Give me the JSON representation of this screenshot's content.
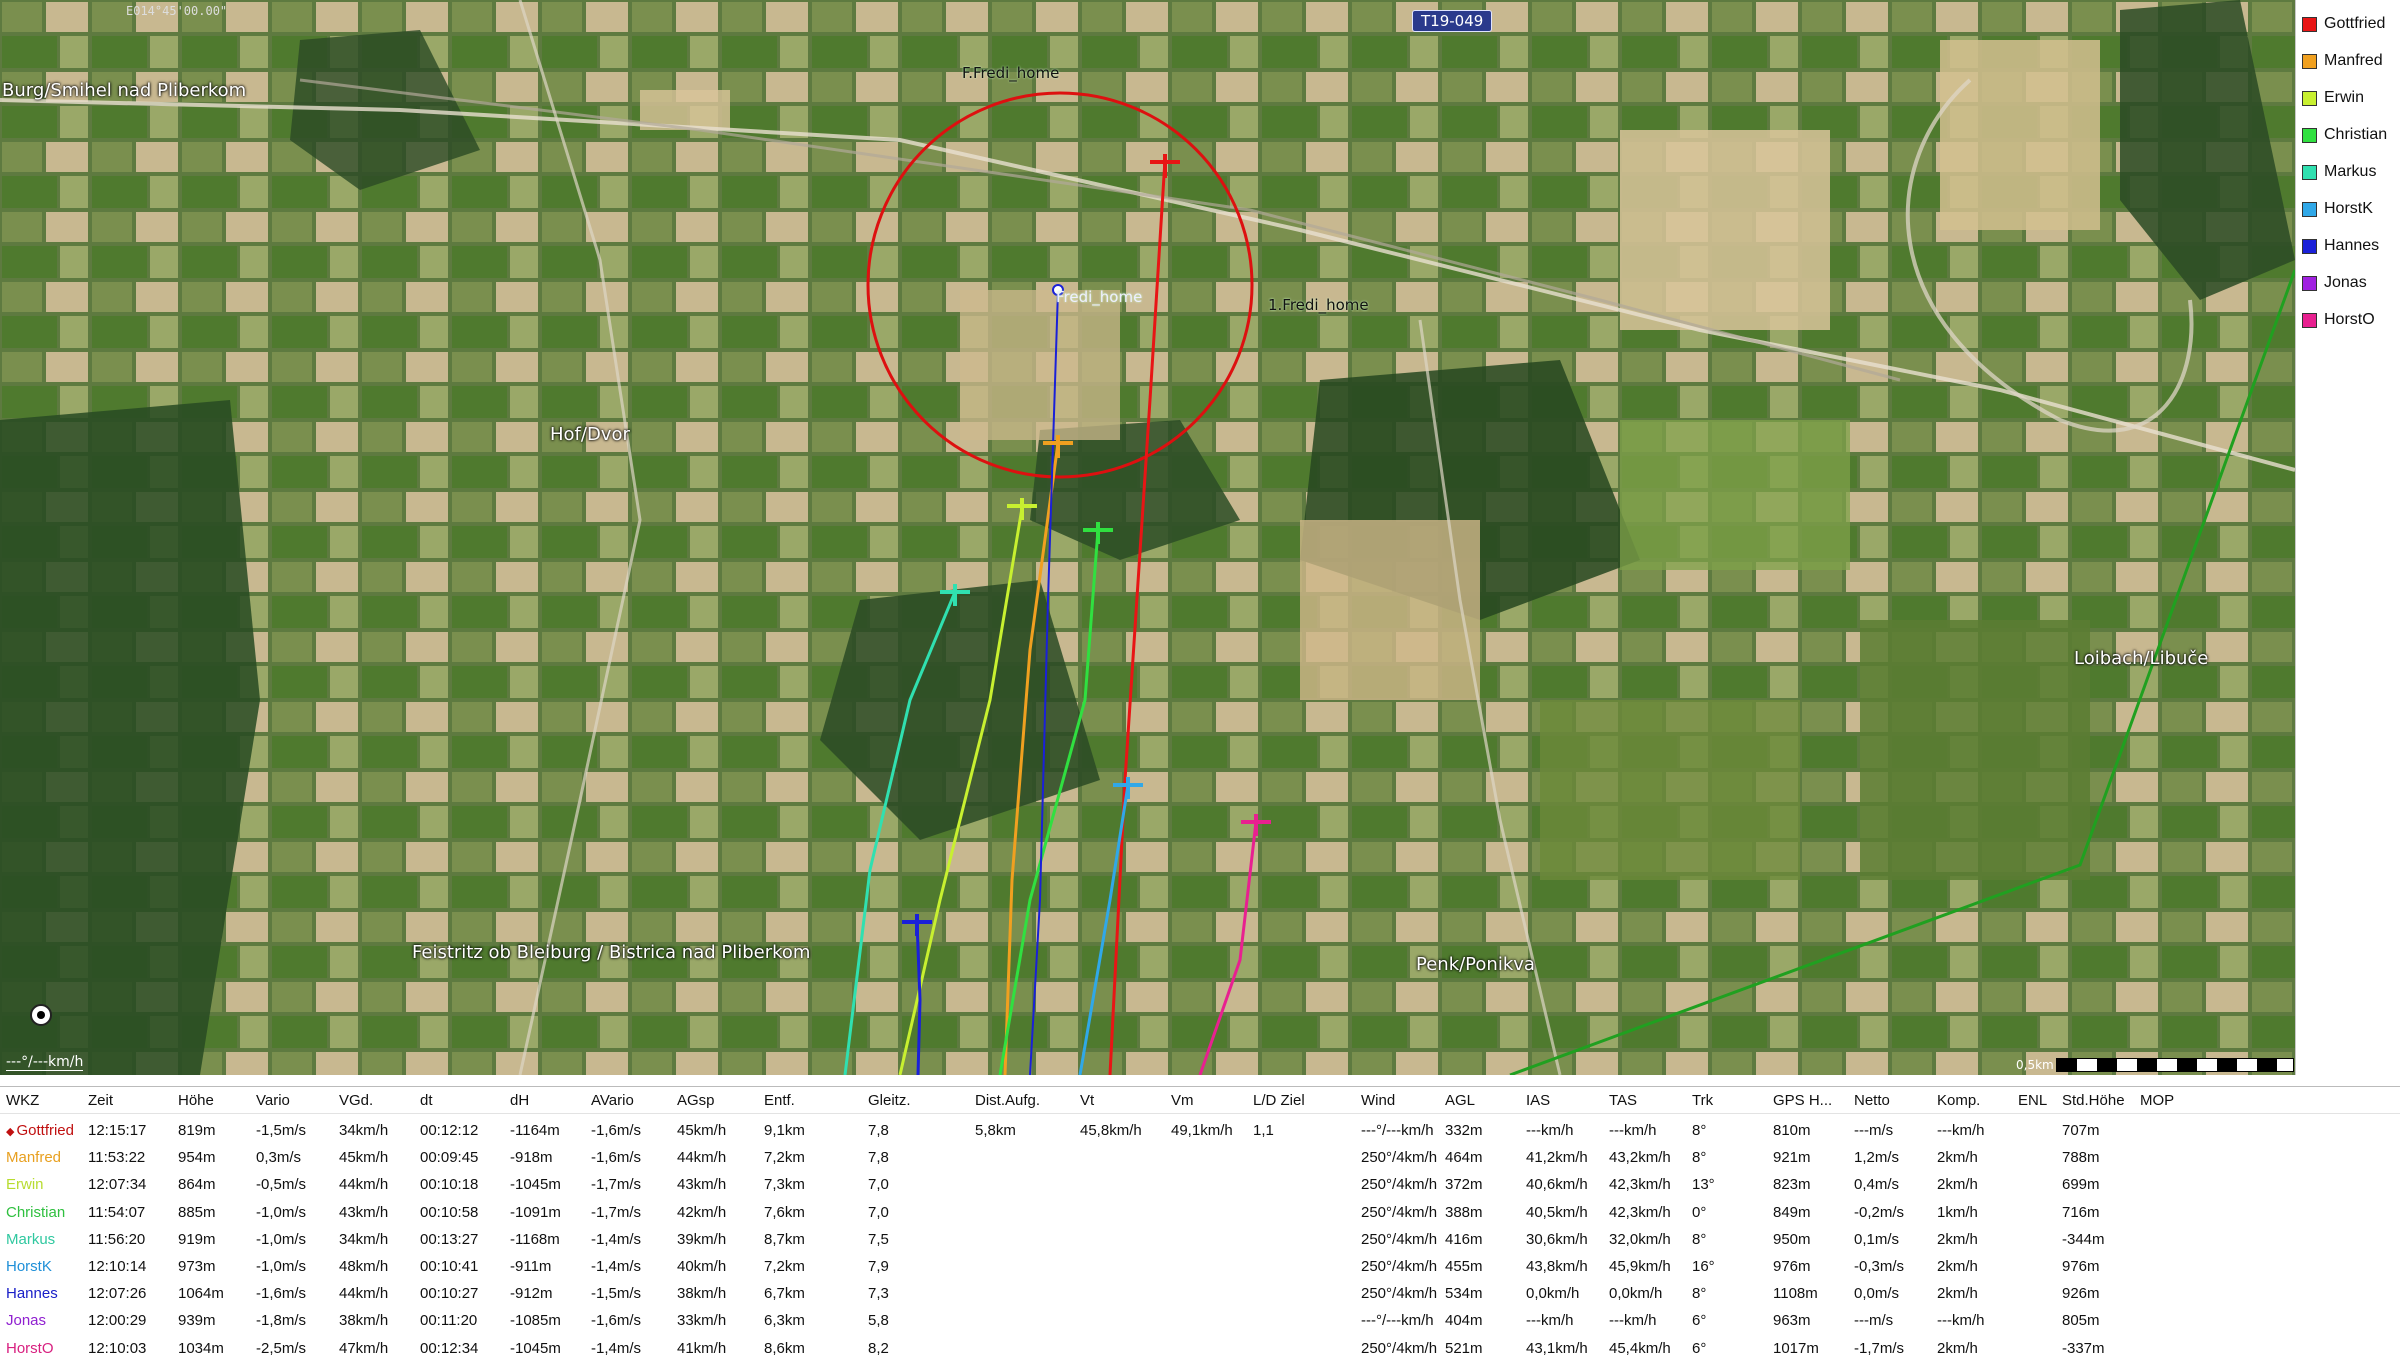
{
  "map": {
    "coord_label": "E014°45'00.00\"",
    "road_badge": "T19-049",
    "place_labels": [
      "Burg/Smihel nad Pliberkom",
      "Hof/Dvor",
      "Feistritz ob Bleiburg / Bistrica nad Pliberkom",
      "Penk/Ponikva",
      "Loibach/Libuče"
    ],
    "waypoints": [
      "F.Fredi_home",
      "Fredi_home",
      "1.Fredi_home"
    ],
    "speed_readout": "---°/---km/h",
    "scale_label": "0,5km"
  },
  "legend": [
    {
      "name": "Gottfried",
      "color": "#e81515"
    },
    {
      "name": "Manfred",
      "color": "#f0a020"
    },
    {
      "name": "Erwin",
      "color": "#c8f030"
    },
    {
      "name": "Christian",
      "color": "#30e040"
    },
    {
      "name": "Markus",
      "color": "#30e0b0"
    },
    {
      "name": "HorstK",
      "color": "#30a8e8"
    },
    {
      "name": "Hannes",
      "color": "#1a20d8"
    },
    {
      "name": "Jonas",
      "color": "#a020e0"
    },
    {
      "name": "HorstO",
      "color": "#e82090"
    }
  ],
  "table": {
    "columns": [
      "WKZ",
      "Zeit",
      "Höhe",
      "Vario",
      "VGd.",
      "dt",
      "dH",
      "AVario",
      "AGsp",
      "Entf.",
      "Gleitz.",
      "Dist.Aufg.",
      "Vt",
      "Vm",
      "L/D Ziel",
      "Wind",
      "AGL",
      "IAS",
      "TAS",
      "Trk",
      "GPS H...",
      "Netto",
      "Komp.",
      "ENL",
      "Std.Höhe",
      "MOP"
    ],
    "rows": [
      {
        "name": "Gottfried",
        "color": "#c01010",
        "cells": [
          "12:15:17",
          "819m",
          "-1,5m/s",
          "34km/h",
          "00:12:12",
          "-1164m",
          "-1,6m/s",
          "45km/h",
          "9,1km",
          "7,8",
          "5,8km",
          "45,8km/h",
          "49,1km/h",
          "1,1",
          "---°/---km/h",
          "332m",
          "---km/h",
          "---km/h",
          "8°",
          "810m",
          "---m/s",
          "---km/h",
          "",
          "707m",
          ""
        ]
      },
      {
        "name": "Manfred",
        "color": "#e8a020",
        "cells": [
          "11:53:22",
          "954m",
          "0,3m/s",
          "45km/h",
          "00:09:45",
          "-918m",
          "-1,6m/s",
          "44km/h",
          "7,2km",
          "7,8",
          "",
          "",
          "",
          "",
          "250°/4km/h",
          "464m",
          "41,2km/h",
          "43,2km/h",
          "8°",
          "921m",
          "1,2m/s",
          "2km/h",
          "",
          "788m",
          ""
        ]
      },
      {
        "name": "Erwin",
        "color": "#b8dc30",
        "cells": [
          "12:07:34",
          "864m",
          "-0,5m/s",
          "44km/h",
          "00:10:18",
          "-1045m",
          "-1,7m/s",
          "43km/h",
          "7,3km",
          "7,0",
          "",
          "",
          "",
          "",
          "250°/4km/h",
          "372m",
          "40,6km/h",
          "42,3km/h",
          "13°",
          "823m",
          "0,4m/s",
          "2km/h",
          "",
          "699m",
          ""
        ]
      },
      {
        "name": "Christian",
        "color": "#30c040",
        "cells": [
          "11:54:07",
          "885m",
          "-1,0m/s",
          "43km/h",
          "00:10:58",
          "-1091m",
          "-1,7m/s",
          "42km/h",
          "7,6km",
          "7,0",
          "",
          "",
          "",
          "",
          "250°/4km/h",
          "388m",
          "40,5km/h",
          "42,3km/h",
          "0°",
          "849m",
          "-0,2m/s",
          "1km/h",
          "",
          "716m",
          ""
        ]
      },
      {
        "name": "Markus",
        "color": "#30c8a0",
        "cells": [
          "11:56:20",
          "919m",
          "-1,0m/s",
          "34km/h",
          "00:13:27",
          "-1168m",
          "-1,4m/s",
          "39km/h",
          "8,7km",
          "7,5",
          "",
          "",
          "",
          "",
          "250°/4km/h",
          "416m",
          "30,6km/h",
          "32,0km/h",
          "8°",
          "950m",
          "0,1m/s",
          "2km/h",
          "",
          "-344m",
          ""
        ]
      },
      {
        "name": "HorstK",
        "color": "#2090d8",
        "cells": [
          "12:10:14",
          "973m",
          "-1,0m/s",
          "48km/h",
          "00:10:41",
          "-911m",
          "-1,4m/s",
          "40km/h",
          "7,2km",
          "7,9",
          "",
          "",
          "",
          "",
          "250°/4km/h",
          "455m",
          "43,8km/h",
          "45,9km/h",
          "16°",
          "976m",
          "-0,3m/s",
          "2km/h",
          "",
          "976m",
          ""
        ]
      },
      {
        "name": "Hannes",
        "color": "#1a20c8",
        "cells": [
          "12:07:26",
          "1064m",
          "-1,6m/s",
          "44km/h",
          "00:10:27",
          "-912m",
          "-1,5m/s",
          "38km/h",
          "6,7km",
          "7,3",
          "",
          "",
          "",
          "",
          "250°/4km/h",
          "534m",
          "0,0km/h",
          "0,0km/h",
          "8°",
          "1108m",
          "0,0m/s",
          "2km/h",
          "",
          "926m",
          ""
        ]
      },
      {
        "name": "Jonas",
        "color": "#9020d0",
        "cells": [
          "12:00:29",
          "939m",
          "-1,8m/s",
          "38km/h",
          "00:11:20",
          "-1085m",
          "-1,6m/s",
          "33km/h",
          "6,3km",
          "5,8",
          "",
          "",
          "",
          "",
          "---°/---km/h",
          "404m",
          "---km/h",
          "---km/h",
          "6°",
          "963m",
          "---m/s",
          "---km/h",
          "",
          "805m",
          ""
        ]
      },
      {
        "name": "HorstO",
        "color": "#d82080",
        "cells": [
          "12:10:03",
          "1034m",
          "-2,5m/s",
          "47km/h",
          "00:12:34",
          "-1045m",
          "-1,4m/s",
          "41km/h",
          "8,6km",
          "8,2",
          "",
          "",
          "",
          "",
          "250°/4km/h",
          "521m",
          "43,1km/h",
          "45,4km/h",
          "6°",
          "1017m",
          "-1,7m/s",
          "2km/h",
          "",
          "-337m",
          ""
        ]
      }
    ]
  }
}
